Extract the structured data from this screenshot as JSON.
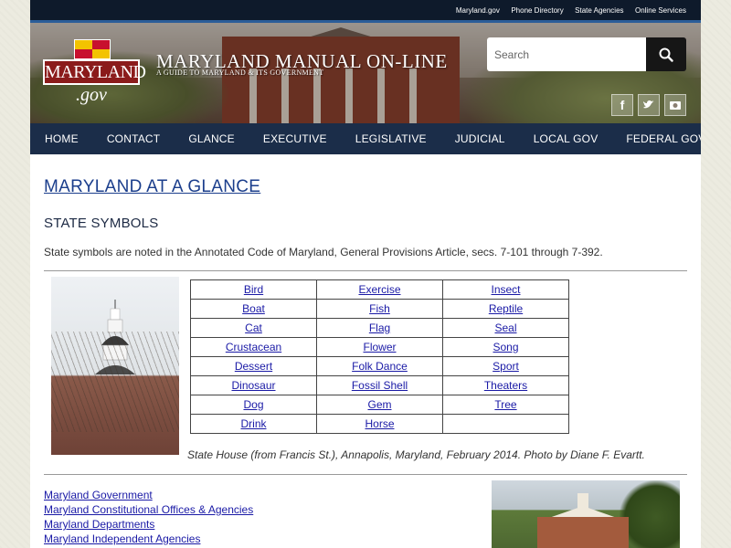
{
  "utility_nav": [
    "Maryland.gov",
    "Phone Directory",
    "State Agencies",
    "Online Services"
  ],
  "logo": {
    "word": "MARYLAND",
    "domain": ".gov"
  },
  "site": {
    "title": "MARYLAND MANUAL ON-LINE",
    "subtitle": "A GUIDE TO MARYLAND & ITS GOVERNMENT"
  },
  "search": {
    "placeholder": "Search"
  },
  "social": {
    "facebook": "f"
  },
  "main_nav": [
    "HOME",
    "CONTACT",
    "GLANCE",
    "EXECUTIVE",
    "LEGISLATIVE",
    "JUDICIAL",
    "LOCAL GOV",
    "FEDERAL GOV"
  ],
  "page": {
    "title": "MARYLAND AT A GLANCE",
    "section_title": "STATE SYMBOLS",
    "intro": "State symbols are noted in the Annotated Code of Maryland, General Provisions Article, secs. 7-101 through 7-392."
  },
  "symbols": [
    [
      "Bird",
      "Exercise",
      "Insect"
    ],
    [
      "Boat",
      "Fish",
      "Reptile"
    ],
    [
      "Cat",
      "Flag",
      "Seal"
    ],
    [
      "Crustacean",
      "Flower",
      "Song"
    ],
    [
      "Dessert",
      "Folk Dance",
      "Sport"
    ],
    [
      "Dinosaur",
      "Fossil Shell",
      "Theaters"
    ],
    [
      "Dog",
      "Gem",
      "Tree"
    ],
    [
      "Drink",
      "Horse",
      ""
    ]
  ],
  "caption": "State House (from Francis St.), Annapolis, Maryland, February 2014. Photo by Diane F. Evartt.",
  "related_links": [
    "Maryland Government",
    "Maryland Constitutional Offices & Agencies",
    "Maryland Departments",
    "Maryland Independent Agencies"
  ],
  "colors": {
    "nav_bg": "#1b2d49",
    "utility_bg": "#0e1a2b",
    "link": "#1a1aa6",
    "title": "#1b3e8c",
    "accent": "#2b5d99"
  }
}
